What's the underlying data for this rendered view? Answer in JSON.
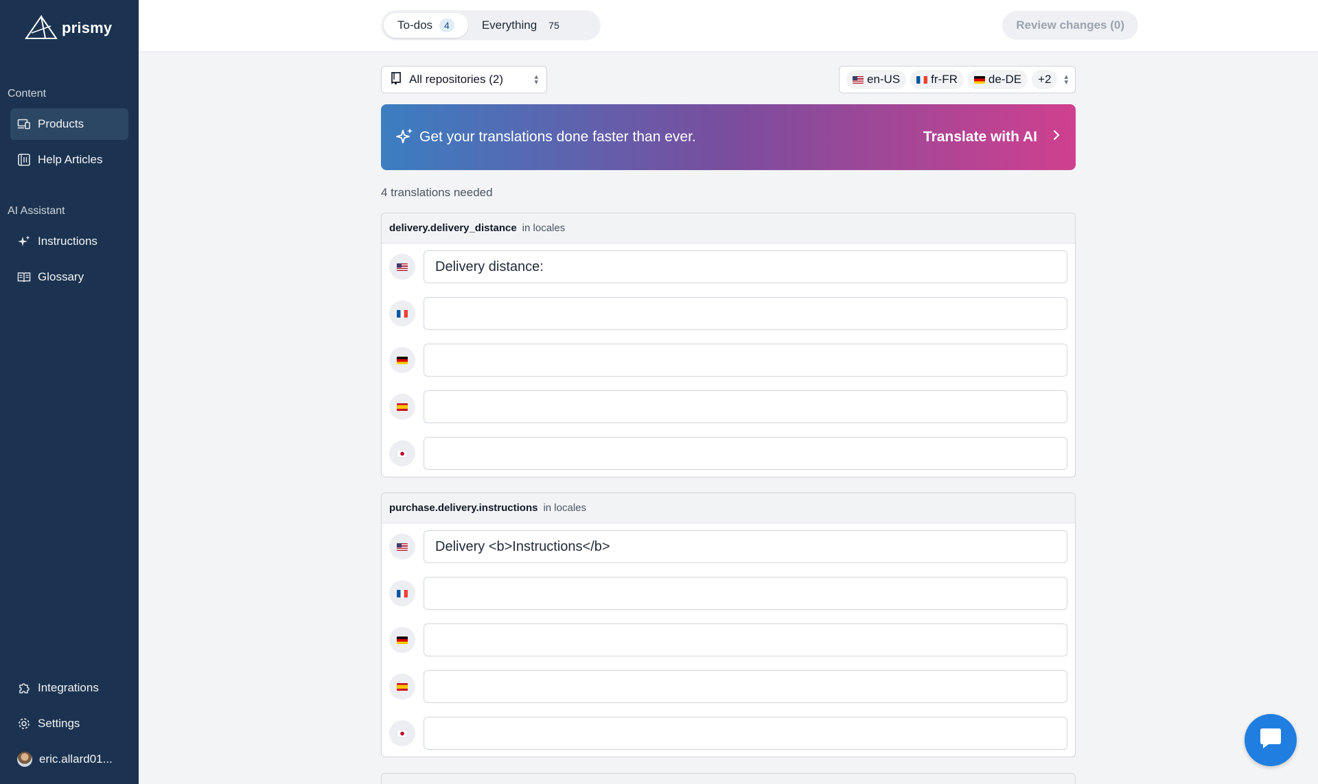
{
  "app": {
    "name": "prismy"
  },
  "sidebar": {
    "sections": [
      {
        "label": "Content",
        "items": [
          {
            "label": "Products",
            "icon": "devices-icon",
            "active": true
          },
          {
            "label": "Help Articles",
            "icon": "book-icon"
          }
        ]
      },
      {
        "label": "AI Assistant",
        "items": [
          {
            "label": "Instructions",
            "icon": "sparkles-icon"
          },
          {
            "label": "Glossary",
            "icon": "open-book-icon"
          }
        ]
      }
    ],
    "footer": [
      {
        "label": "Integrations",
        "icon": "puzzle-icon"
      },
      {
        "label": "Settings",
        "icon": "gear-icon"
      },
      {
        "label": "eric.allard01...",
        "icon": "avatar"
      }
    ]
  },
  "topbar": {
    "tabs": [
      {
        "label": "To-dos",
        "count": "4",
        "active": true
      },
      {
        "label": "Everything",
        "count": "75"
      }
    ],
    "review_button": "Review changes (0)"
  },
  "filters": {
    "repositories": "All repositories (2)",
    "locales": [
      "en-US",
      "fr-FR",
      "de-DE"
    ],
    "locales_more": "+2"
  },
  "banner": {
    "text": "Get your translations done faster than ever.",
    "cta": "Translate with AI"
  },
  "summary": "4 translations needed",
  "cards": [
    {
      "key": "delivery.delivery_distance",
      "context": "in locales",
      "rows": [
        {
          "locale": "en-US",
          "value": "Delivery distance:"
        },
        {
          "locale": "fr-FR",
          "value": ""
        },
        {
          "locale": "de-DE",
          "value": ""
        },
        {
          "locale": "es-ES",
          "value": ""
        },
        {
          "locale": "ja-JP",
          "value": ""
        }
      ]
    },
    {
      "key": "purchase.delivery.instructions",
      "context": "in locales",
      "rows": [
        {
          "locale": "en-US",
          "value": "Delivery <b>Instructions</b>"
        },
        {
          "locale": "fr-FR",
          "value": ""
        },
        {
          "locale": "de-DE",
          "value": ""
        },
        {
          "locale": "es-ES",
          "value": ""
        },
        {
          "locale": "ja-JP",
          "value": ""
        }
      ]
    }
  ],
  "colors": {
    "sidebar_bg": "#1b3350",
    "accent": "#1f7ee0",
    "banner_start": "#3b7ec1",
    "banner_end": "#d0408f"
  }
}
